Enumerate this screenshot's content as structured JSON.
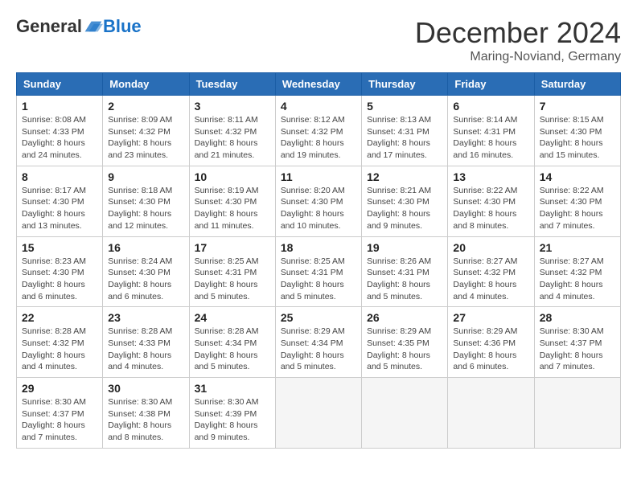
{
  "header": {
    "logo_general": "General",
    "logo_blue": "Blue",
    "title": "December 2024",
    "subtitle": "Maring-Noviand, Germany"
  },
  "columns": [
    "Sunday",
    "Monday",
    "Tuesday",
    "Wednesday",
    "Thursday",
    "Friday",
    "Saturday"
  ],
  "weeks": [
    [
      {
        "day": "1",
        "sunrise": "8:08 AM",
        "sunset": "4:33 PM",
        "daylight": "8 hours and 24 minutes."
      },
      {
        "day": "2",
        "sunrise": "8:09 AM",
        "sunset": "4:32 PM",
        "daylight": "8 hours and 23 minutes."
      },
      {
        "day": "3",
        "sunrise": "8:11 AM",
        "sunset": "4:32 PM",
        "daylight": "8 hours and 21 minutes."
      },
      {
        "day": "4",
        "sunrise": "8:12 AM",
        "sunset": "4:32 PM",
        "daylight": "8 hours and 19 minutes."
      },
      {
        "day": "5",
        "sunrise": "8:13 AM",
        "sunset": "4:31 PM",
        "daylight": "8 hours and 17 minutes."
      },
      {
        "day": "6",
        "sunrise": "8:14 AM",
        "sunset": "4:31 PM",
        "daylight": "8 hours and 16 minutes."
      },
      {
        "day": "7",
        "sunrise": "8:15 AM",
        "sunset": "4:30 PM",
        "daylight": "8 hours and 15 minutes."
      }
    ],
    [
      {
        "day": "8",
        "sunrise": "8:17 AM",
        "sunset": "4:30 PM",
        "daylight": "8 hours and 13 minutes."
      },
      {
        "day": "9",
        "sunrise": "8:18 AM",
        "sunset": "4:30 PM",
        "daylight": "8 hours and 12 minutes."
      },
      {
        "day": "10",
        "sunrise": "8:19 AM",
        "sunset": "4:30 PM",
        "daylight": "8 hours and 11 minutes."
      },
      {
        "day": "11",
        "sunrise": "8:20 AM",
        "sunset": "4:30 PM",
        "daylight": "8 hours and 10 minutes."
      },
      {
        "day": "12",
        "sunrise": "8:21 AM",
        "sunset": "4:30 PM",
        "daylight": "8 hours and 9 minutes."
      },
      {
        "day": "13",
        "sunrise": "8:22 AM",
        "sunset": "4:30 PM",
        "daylight": "8 hours and 8 minutes."
      },
      {
        "day": "14",
        "sunrise": "8:22 AM",
        "sunset": "4:30 PM",
        "daylight": "8 hours and 7 minutes."
      }
    ],
    [
      {
        "day": "15",
        "sunrise": "8:23 AM",
        "sunset": "4:30 PM",
        "daylight": "8 hours and 6 minutes."
      },
      {
        "day": "16",
        "sunrise": "8:24 AM",
        "sunset": "4:30 PM",
        "daylight": "8 hours and 6 minutes."
      },
      {
        "day": "17",
        "sunrise": "8:25 AM",
        "sunset": "4:31 PM",
        "daylight": "8 hours and 5 minutes."
      },
      {
        "day": "18",
        "sunrise": "8:25 AM",
        "sunset": "4:31 PM",
        "daylight": "8 hours and 5 minutes."
      },
      {
        "day": "19",
        "sunrise": "8:26 AM",
        "sunset": "4:31 PM",
        "daylight": "8 hours and 5 minutes."
      },
      {
        "day": "20",
        "sunrise": "8:27 AM",
        "sunset": "4:32 PM",
        "daylight": "8 hours and 4 minutes."
      },
      {
        "day": "21",
        "sunrise": "8:27 AM",
        "sunset": "4:32 PM",
        "daylight": "8 hours and 4 minutes."
      }
    ],
    [
      {
        "day": "22",
        "sunrise": "8:28 AM",
        "sunset": "4:32 PM",
        "daylight": "8 hours and 4 minutes."
      },
      {
        "day": "23",
        "sunrise": "8:28 AM",
        "sunset": "4:33 PM",
        "daylight": "8 hours and 4 minutes."
      },
      {
        "day": "24",
        "sunrise": "8:28 AM",
        "sunset": "4:34 PM",
        "daylight": "8 hours and 5 minutes."
      },
      {
        "day": "25",
        "sunrise": "8:29 AM",
        "sunset": "4:34 PM",
        "daylight": "8 hours and 5 minutes."
      },
      {
        "day": "26",
        "sunrise": "8:29 AM",
        "sunset": "4:35 PM",
        "daylight": "8 hours and 5 minutes."
      },
      {
        "day": "27",
        "sunrise": "8:29 AM",
        "sunset": "4:36 PM",
        "daylight": "8 hours and 6 minutes."
      },
      {
        "day": "28",
        "sunrise": "8:30 AM",
        "sunset": "4:37 PM",
        "daylight": "8 hours and 7 minutes."
      }
    ],
    [
      {
        "day": "29",
        "sunrise": "8:30 AM",
        "sunset": "4:37 PM",
        "daylight": "8 hours and 7 minutes."
      },
      {
        "day": "30",
        "sunrise": "8:30 AM",
        "sunset": "4:38 PM",
        "daylight": "8 hours and 8 minutes."
      },
      {
        "day": "31",
        "sunrise": "8:30 AM",
        "sunset": "4:39 PM",
        "daylight": "8 hours and 9 minutes."
      },
      null,
      null,
      null,
      null
    ]
  ],
  "labels": {
    "sunrise": "Sunrise:",
    "sunset": "Sunset:",
    "daylight": "Daylight:"
  }
}
